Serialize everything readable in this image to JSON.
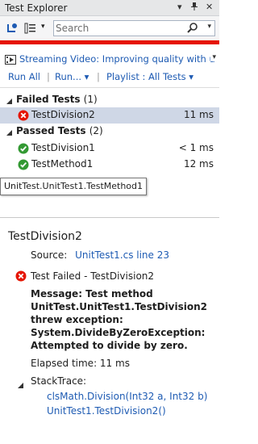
{
  "window": {
    "title": "Test Explorer",
    "dropdown_glyph": "▾",
    "pin_glyph": "ᵖ",
    "close_glyph": "✕"
  },
  "toolbar": {
    "search_placeholder": "Search",
    "dropdown_glyph": "▾"
  },
  "status_color": "#e51400",
  "playlist_banner": {
    "text": "Streaming Video: Improving quality with u",
    "dropdown_glyph": "▾"
  },
  "actions": {
    "run_all": "Run All",
    "sep1": "|",
    "run": "Run... ▾",
    "sep2": "|",
    "playlist": "Playlist : All Tests ▾"
  },
  "groups": {
    "failed": {
      "label": "Failed Tests",
      "count": "(1)",
      "tests": [
        {
          "name": "TestDivision2",
          "duration": "11 ms",
          "status": "failed"
        }
      ]
    },
    "passed": {
      "label": "Passed Tests",
      "count": "(2)",
      "tests": [
        {
          "name": "TestDivision1",
          "duration": "< 1 ms",
          "status": "passed"
        },
        {
          "name": "TestMethod1",
          "duration": "12 ms",
          "status": "passed"
        }
      ]
    }
  },
  "tooltip": "UnitTest.UnitTest1.TestMethod1",
  "detail": {
    "title": "TestDivision2",
    "source_label": "Source:",
    "source_link": "UnitTest1.cs line 23",
    "result": "Test Failed - TestDivision2",
    "message": "Message: Test method UnitTest.UnitTest1.TestDivision2 threw exception: System.DivideByZeroException: Attempted to divide by zero.",
    "elapsed": "Elapsed time: 11 ms",
    "stacktrace_label": "StackTrace:",
    "frames": [
      "clsMath.Division(Int32 a, Int32 b)",
      "UnitTest1.TestDivision2()"
    ]
  },
  "icons": {
    "failed": "error-x-icon",
    "passed": "check-circle-icon",
    "run": "run-tests-icon",
    "group_by": "group-by-icon",
    "search": "search-icon",
    "video": "video-icon"
  }
}
